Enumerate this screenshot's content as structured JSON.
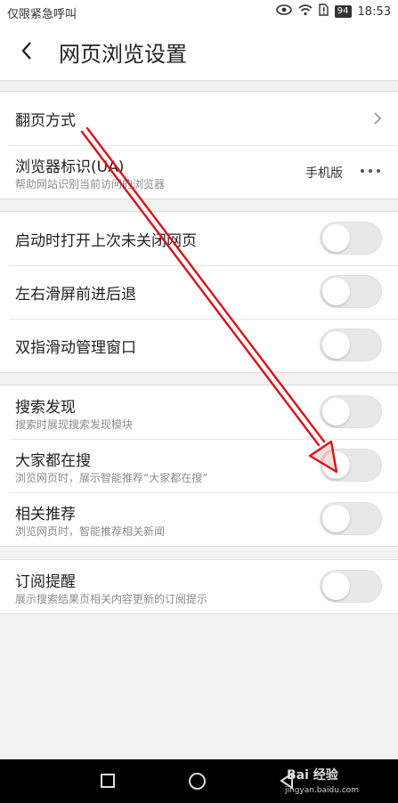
{
  "status_bar": {
    "carrier": "仅限紧急呼叫",
    "battery": "94",
    "time": "18:53"
  },
  "header": {
    "title": "网页浏览设置"
  },
  "groups": [
    {
      "rows": [
        {
          "label": "翻页方式",
          "control": "chevron"
        },
        {
          "label": "浏览器标识(UA)",
          "sub": "帮助网站识别当前访问的浏览器",
          "value": "手机版",
          "control": "more"
        }
      ]
    },
    {
      "rows": [
        {
          "label": "启动时打开上次未关闭网页",
          "control": "toggle",
          "on": false
        },
        {
          "label": "左右滑屏前进后退",
          "control": "toggle",
          "on": false
        },
        {
          "label": "双指滑动管理窗口",
          "control": "toggle",
          "on": false
        }
      ]
    },
    {
      "rows": [
        {
          "label": "搜索发现",
          "sub": "搜索时展现搜索发现模块",
          "control": "toggle",
          "on": false
        },
        {
          "label": "大家都在搜",
          "sub": "浏览网页时，展示智能推荐“大家都在搜”",
          "control": "toggle",
          "on": false
        },
        {
          "label": "相关推荐",
          "sub": "浏览网页时，智能推荐相关新闻",
          "control": "toggle",
          "on": false
        }
      ]
    },
    {
      "rows": [
        {
          "label": "订阅提醒",
          "sub": "展示搜索结果页相关内容更新的订阅提示",
          "control": "toggle",
          "on": false
        }
      ]
    }
  ],
  "watermark": {
    "brand": "Bai 经验",
    "url": "jingyan.baidu.com"
  },
  "colors": {
    "annotation_arrow": "#d8141c",
    "toggle_off": "#e8e8e8"
  }
}
